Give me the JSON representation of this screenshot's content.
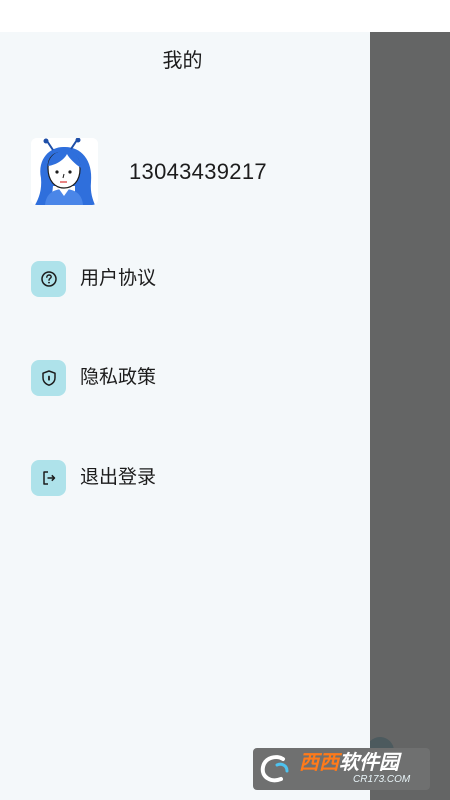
{
  "drawer": {
    "title": "我的",
    "user": {
      "phone": "13043439217"
    },
    "menu": [
      {
        "label": "用户协议",
        "icon": "question-circle-icon"
      },
      {
        "label": "隐私政策",
        "icon": "shield-lock-icon"
      },
      {
        "label": "退出登录",
        "icon": "logout-icon"
      }
    ]
  },
  "watermark": {
    "text_a": "西西",
    "text_b": "软件园",
    "sub": "CR173.COM"
  },
  "colors": {
    "drawer_bg": "#f4f8fa",
    "icon_bg": "#aee2ea",
    "scrim": "#646565",
    "text": "#1c1c1c"
  }
}
